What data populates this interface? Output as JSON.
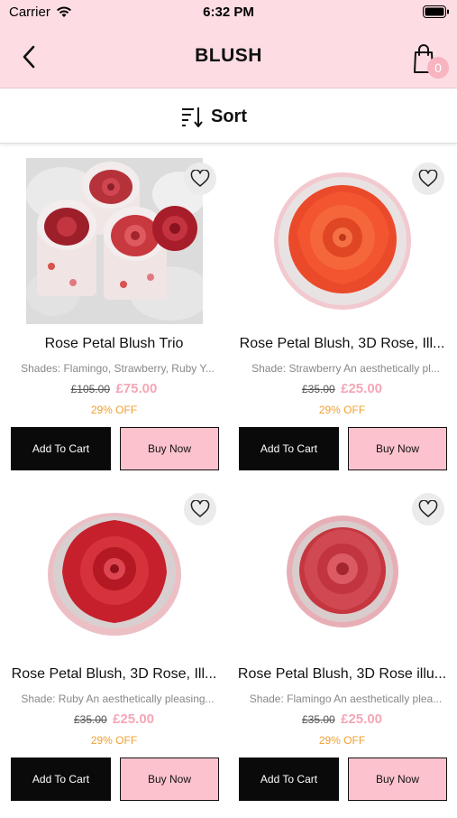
{
  "status_bar": {
    "carrier": "Carrier",
    "time": "6:32 PM"
  },
  "header": {
    "title": "BLUSH",
    "cart_count": "0"
  },
  "sort": {
    "label": "Sort"
  },
  "products": [
    {
      "name": "Rose Petal Blush Trio",
      "description": "Shades: Flamingo, Strawberry, Ruby Y...",
      "old_price": "£105.00",
      "new_price": "£75.00",
      "discount": "29% OFF",
      "add_label": "Add To Cart",
      "buy_label": "Buy Now"
    },
    {
      "name": "Rose Petal Blush, 3D Rose,  Ill...",
      "description": "Shade: Strawberry An aesthetically pl...",
      "old_price": "£35.00",
      "new_price": "£25.00",
      "discount": "29% OFF",
      "add_label": "Add To Cart",
      "buy_label": "Buy Now"
    },
    {
      "name": "Rose Petal Blush, 3D Rose, Ill...",
      "description": "Shade: Ruby An aesthetically pleasing...",
      "old_price": "£35.00",
      "new_price": "£25.00",
      "discount": "29% OFF",
      "add_label": "Add To Cart",
      "buy_label": "Buy Now"
    },
    {
      "name": "Rose Petal Blush, 3D Rose illu...",
      "description": "Shade: Flamingo An aesthetically plea...",
      "old_price": "£35.00",
      "new_price": "£25.00",
      "discount": "29% OFF",
      "add_label": "Add To Cart",
      "buy_label": "Buy Now"
    }
  ],
  "colors": {
    "header_bg": "#fddde3",
    "price_pink": "#f4a6b6",
    "discount_orange": "#f0a030",
    "buy_button_bg": "#fcc3ce"
  },
  "icons": {
    "back": "chevron-left-icon",
    "cart": "shopping-bag-icon",
    "sort": "sort-icon",
    "favorite": "heart-icon"
  }
}
